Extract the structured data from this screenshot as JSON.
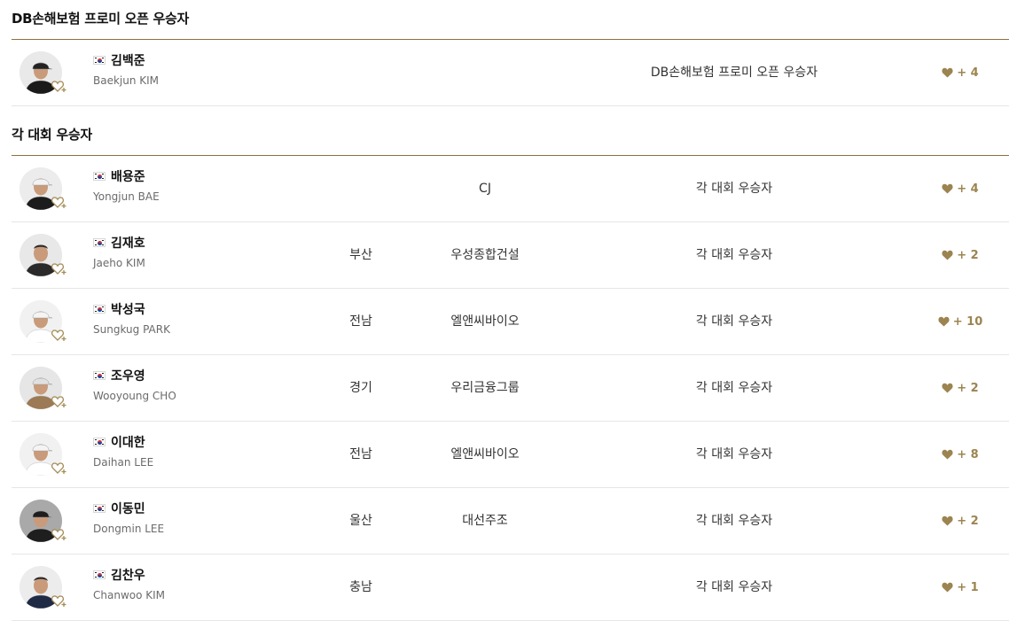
{
  "sections": [
    {
      "title": "DB손해보험 프로미 오픈 우승자",
      "rows": [
        {
          "name_ko": "김백준",
          "name_en": "Baekjun KIM",
          "region": "",
          "sponsor": "",
          "category": "DB손해보험 프로미 오픈 우승자",
          "likes": "+ 4",
          "shirt": "#1a1a1a",
          "cap": "#222222",
          "bg": "#e9e9e9"
        }
      ]
    },
    {
      "title": "각 대회 우승자",
      "rows": [
        {
          "name_ko": "배용준",
          "name_en": "Yongjun BAE",
          "region": "",
          "sponsor": "CJ",
          "category": "각 대회 우승자",
          "likes": "+ 4",
          "shirt": "#1c1c1c",
          "cap": "#f2f2f2",
          "bg": "#ececec"
        },
        {
          "name_ko": "김재호",
          "name_en": "Jaeho KIM",
          "region": "부산",
          "sponsor": "우성종합건설",
          "category": "각 대회 우승자",
          "likes": "+ 2",
          "shirt": "#2a2a2a",
          "cap": "",
          "bg": "#e8e8e8"
        },
        {
          "name_ko": "박성국",
          "name_en": "Sungkug PARK",
          "region": "전남",
          "sponsor": "엘앤씨바이오",
          "category": "각 대회 우승자",
          "likes": "+ 10",
          "shirt": "#ffffff",
          "cap": "#f4f4f4",
          "bg": "#f1f1f1"
        },
        {
          "name_ko": "조우영",
          "name_en": "Wooyoung CHO",
          "region": "경기",
          "sponsor": "우리금융그룹",
          "category": "각 대회 우승자",
          "likes": "+ 2",
          "shirt": "#9b7a55",
          "cap": "#e0e0e0",
          "bg": "#e6e6e6"
        },
        {
          "name_ko": "이대한",
          "name_en": "Daihan LEE",
          "region": "전남",
          "sponsor": "엘앤씨바이오",
          "category": "각 대회 우승자",
          "likes": "+ 8",
          "shirt": "#ffffff",
          "cap": "#f4f4f4",
          "bg": "#f1f1f1"
        },
        {
          "name_ko": "이동민",
          "name_en": "Dongmin LEE",
          "region": "울산",
          "sponsor": "대선주조",
          "category": "각 대회 우승자",
          "likes": "+ 2",
          "shirt": "#1e1e1e",
          "cap": "#1e1e1e",
          "bg": "#a9a9a9"
        },
        {
          "name_ko": "김찬우",
          "name_en": "Chanwoo KIM",
          "region": "충남",
          "sponsor": "",
          "category": "각 대회 우승자",
          "likes": "+ 1",
          "shirt": "#1f2a44",
          "cap": "",
          "bg": "#ececec"
        }
      ]
    }
  ],
  "icons": {
    "favorite": "heart-plus-icon",
    "likes": "heart-icon",
    "flag": "korea-flag-icon"
  },
  "colors": {
    "accent": "#9c8450",
    "rule": "#8a7340",
    "divider": "#e6e6e6"
  }
}
